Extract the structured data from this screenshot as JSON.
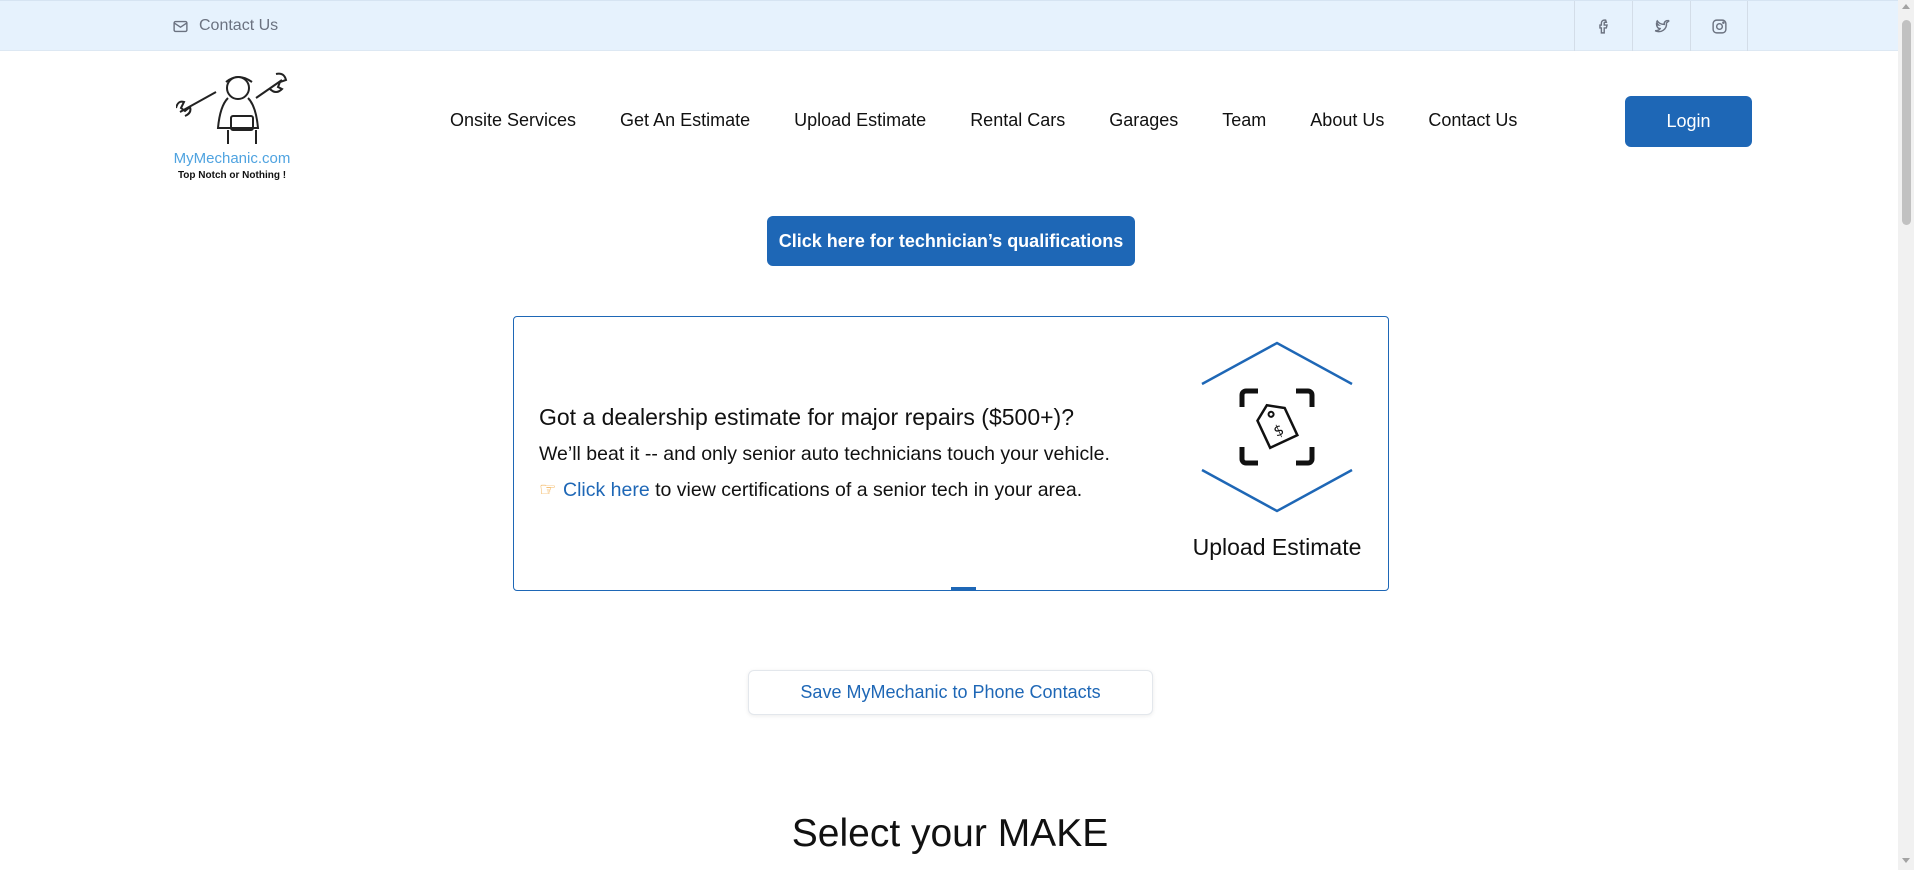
{
  "topbar": {
    "contact_label": "Contact Us",
    "socials": [
      "facebook-icon",
      "twitter-icon",
      "instagram-icon"
    ]
  },
  "logo": {
    "name": "MyMechanic.com",
    "tagline": "Top Notch or Nothing !"
  },
  "nav": {
    "items": [
      "Onsite Services",
      "Get An Estimate",
      "Upload Estimate",
      "Rental Cars",
      "Garages",
      "Team",
      "About Us",
      "Contact Us"
    ],
    "login_label": "Login"
  },
  "qualifications_button": "Click here for technician’s qualifications",
  "promo_card": {
    "heading": "Got a dealership estimate for major repairs ($500+)?",
    "line1": "We’ll beat it -- and only senior auto technicians touch your vehicle.",
    "link_text": "Click here",
    "line2_rest": " to view certifications of a senior tech in your area.",
    "upload_label": "Upload Estimate"
  },
  "save_contacts_button": "Save MyMechanic to Phone Contacts",
  "section_title": "Select your MAKE",
  "colors": {
    "brand_blue": "#1e67b6",
    "topbar_bg": "#e6f2fd",
    "logo_text": "#4fa3e0"
  }
}
